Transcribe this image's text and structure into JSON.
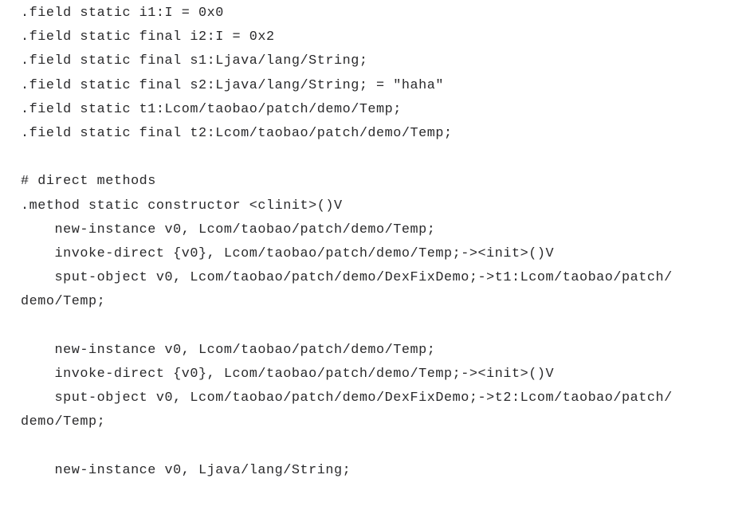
{
  "document": {
    "kind": "smali-disassembly-listing",
    "background_color": "#ffffff",
    "text_color": "#29292b",
    "lines": [
      {
        "id": 1,
        "text": ".field static i1:I = 0x0"
      },
      {
        "id": 2,
        "text": ".field static final i2:I = 0x2"
      },
      {
        "id": 3,
        "text": ".field static final s1:Ljava/lang/String;"
      },
      {
        "id": 4,
        "text": ".field static final s2:Ljava/lang/String; = \"haha\""
      },
      {
        "id": 5,
        "text": ".field static t1:Lcom/taobao/patch/demo/Temp;"
      },
      {
        "id": 6,
        "text": ".field static final t2:Lcom/taobao/patch/demo/Temp;"
      },
      {
        "id": 7,
        "text": ""
      },
      {
        "id": 8,
        "text": "# direct methods"
      },
      {
        "id": 9,
        "text": ".method static constructor <clinit>()V"
      },
      {
        "id": 10,
        "text": "    new-instance v0, Lcom/taobao/patch/demo/Temp;"
      },
      {
        "id": 11,
        "text": "    invoke-direct {v0}, Lcom/taobao/patch/demo/Temp;-><init>()V"
      },
      {
        "id": 12,
        "text": "    sput-object v0, Lcom/taobao/patch/demo/DexFixDemo;->t1:Lcom/taobao/patch/"
      },
      {
        "id": 13,
        "text": "demo/Temp;"
      },
      {
        "id": 14,
        "text": ""
      },
      {
        "id": 15,
        "text": "    new-instance v0, Lcom/taobao/patch/demo/Temp;"
      },
      {
        "id": 16,
        "text": "    invoke-direct {v0}, Lcom/taobao/patch/demo/Temp;-><init>()V"
      },
      {
        "id": 17,
        "text": "    sput-object v0, Lcom/taobao/patch/demo/DexFixDemo;->t2:Lcom/taobao/patch/"
      },
      {
        "id": 18,
        "text": "demo/Temp;"
      },
      {
        "id": 19,
        "text": ""
      },
      {
        "id": 20,
        "text": "    new-instance v0, Ljava/lang/String;"
      }
    ]
  }
}
